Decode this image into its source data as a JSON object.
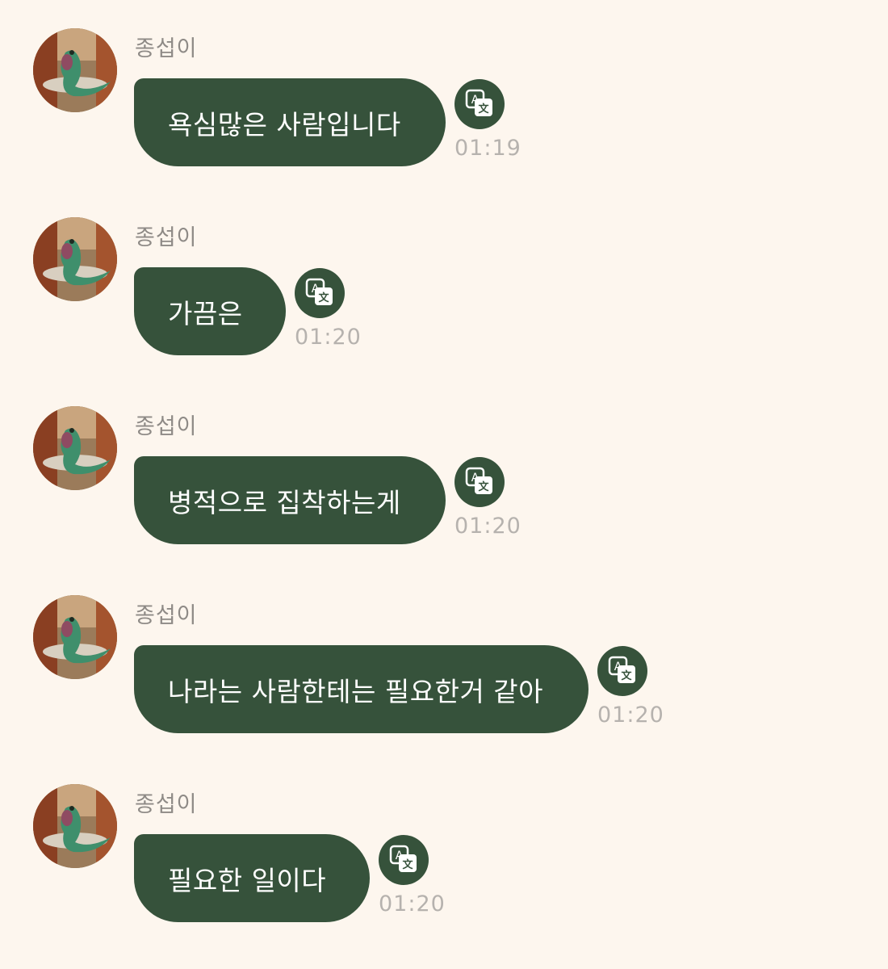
{
  "colors": {
    "background": "#fdf6ee",
    "bubble": "#36523b",
    "bubble_text": "#ffffff",
    "sender_text": "#8e8a86",
    "time_text": "#b6b2ae"
  },
  "messages": [
    {
      "sender": "종섭이",
      "text": "욕심많은 사람입니다",
      "time": "01:19",
      "avatar_icon": "lizard-avatar",
      "translate_icon": "translate-icon"
    },
    {
      "sender": "종섭이",
      "text": "가끔은",
      "time": "01:20",
      "avatar_icon": "lizard-avatar",
      "translate_icon": "translate-icon"
    },
    {
      "sender": "종섭이",
      "text": "병적으로 집착하는게",
      "time": "01:20",
      "avatar_icon": "lizard-avatar",
      "translate_icon": "translate-icon"
    },
    {
      "sender": "종섭이",
      "text": "나라는 사람한테는 필요한거 같아",
      "time": "01:20",
      "avatar_icon": "lizard-avatar",
      "translate_icon": "translate-icon"
    },
    {
      "sender": "종섭이",
      "text": "필요한 일이다",
      "time": "01:20",
      "avatar_icon": "lizard-avatar",
      "translate_icon": "translate-icon"
    }
  ]
}
